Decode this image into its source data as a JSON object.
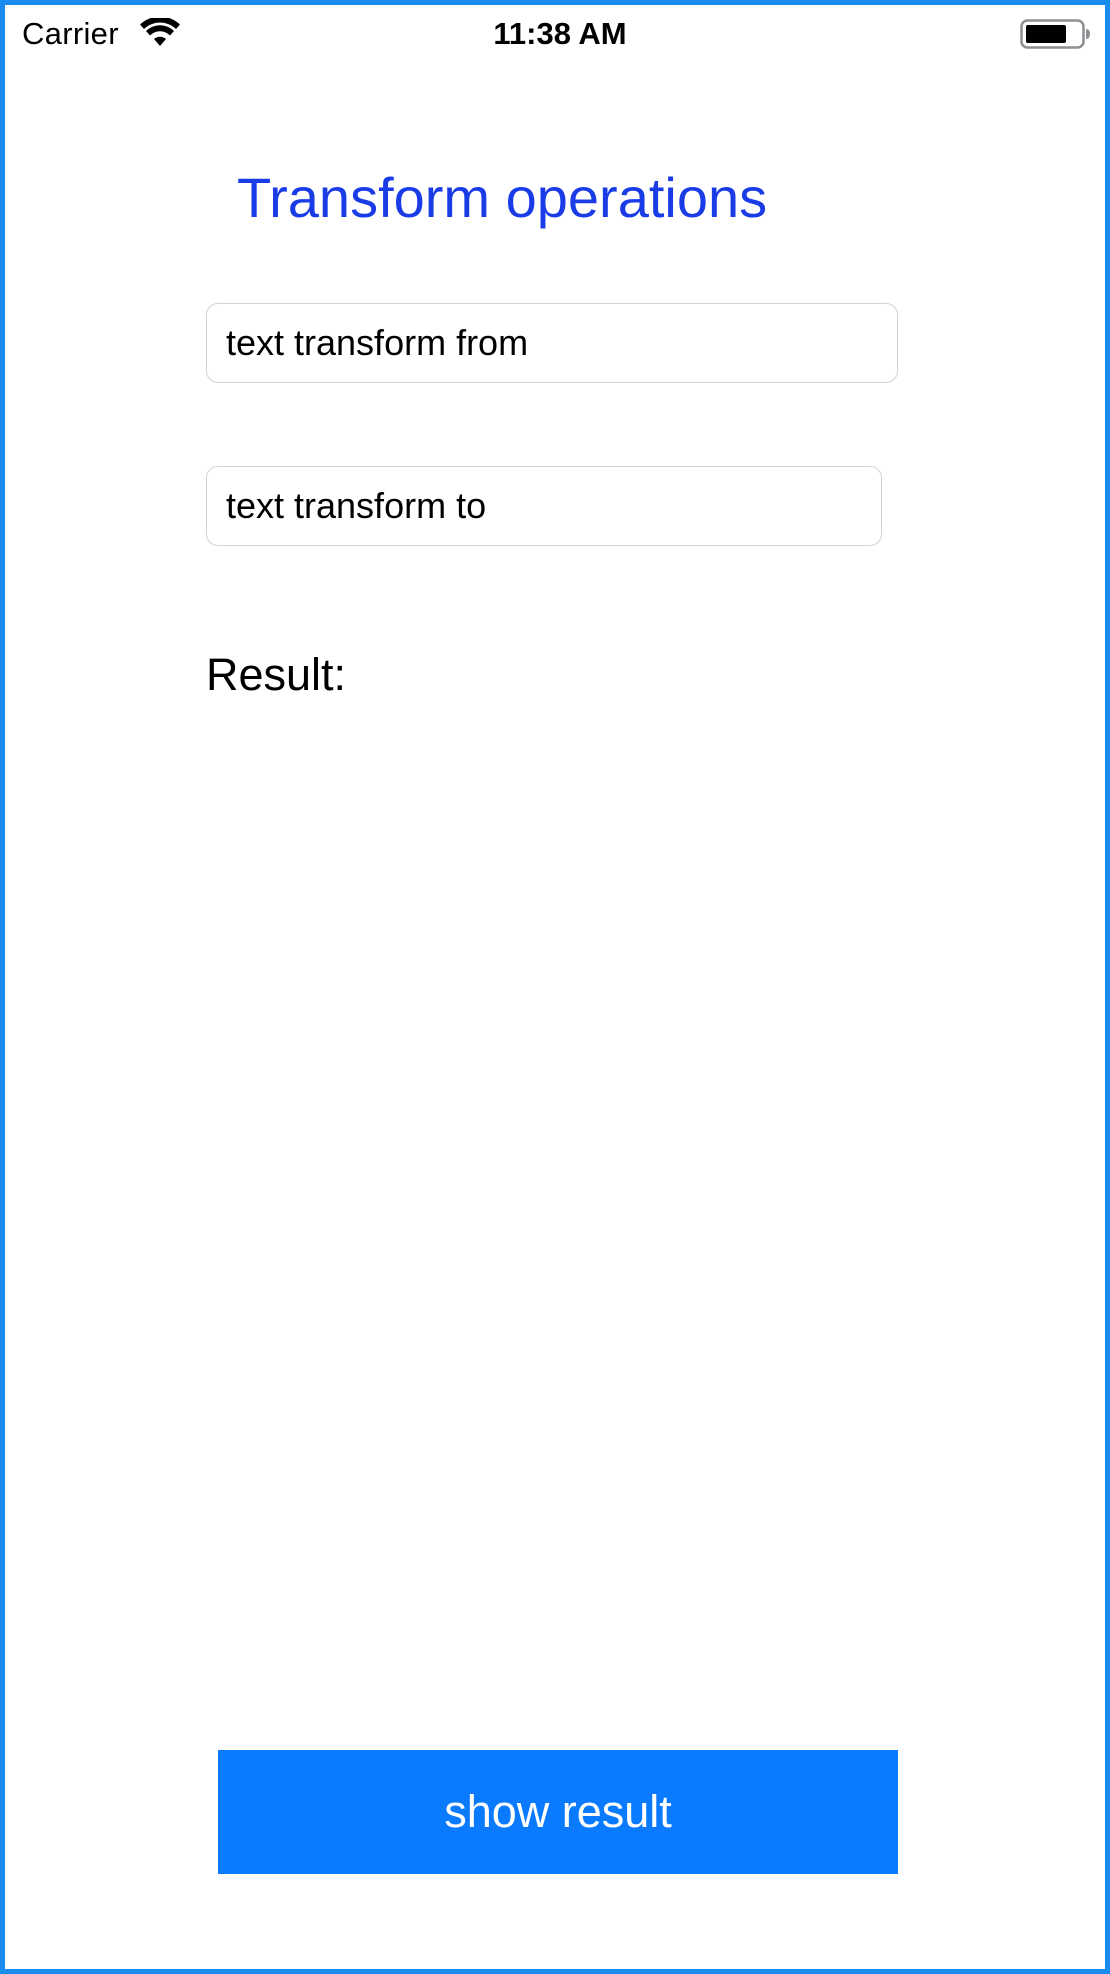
{
  "status_bar": {
    "carrier": "Carrier",
    "time": "11:38 AM",
    "wifi_icon": "wifi-icon",
    "battery_icon": "battery-icon"
  },
  "header": {
    "title": "Transform operations"
  },
  "form": {
    "from_placeholder": "text transform from",
    "to_placeholder": "text transform to"
  },
  "result": {
    "label": "Result:"
  },
  "actions": {
    "show_result_label": "show result"
  },
  "colors": {
    "border": "#1a8cf0",
    "title": "#1a3ce6",
    "button": "#0a7bff"
  }
}
